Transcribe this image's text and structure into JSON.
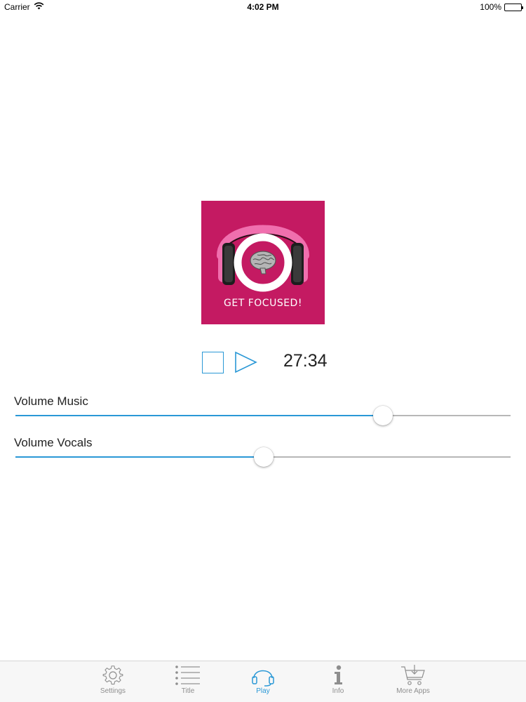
{
  "status_bar": {
    "carrier": "Carrier",
    "time": "4:02 PM",
    "battery": "100%"
  },
  "cover": {
    "caption": "GET FOCUSED!",
    "background_color": "#c41a62"
  },
  "player": {
    "time": "27:34",
    "stop_icon": "stop-icon",
    "play_icon": "play-icon",
    "accent_color": "#2a98d6"
  },
  "sliders": {
    "music": {
      "label": "Volume Music",
      "value": 0.742
    },
    "vocals": {
      "label": "Volume Vocals",
      "value": 0.501
    }
  },
  "tab_bar": {
    "items": [
      {
        "label": "Settings",
        "icon": "gear-icon",
        "active": false
      },
      {
        "label": "Title",
        "icon": "list-icon",
        "active": false
      },
      {
        "label": "Play",
        "icon": "headphones-icon",
        "active": true
      },
      {
        "label": "Info",
        "icon": "info-icon",
        "active": false
      },
      {
        "label": "More Apps",
        "icon": "cart-icon",
        "active": false
      }
    ]
  }
}
